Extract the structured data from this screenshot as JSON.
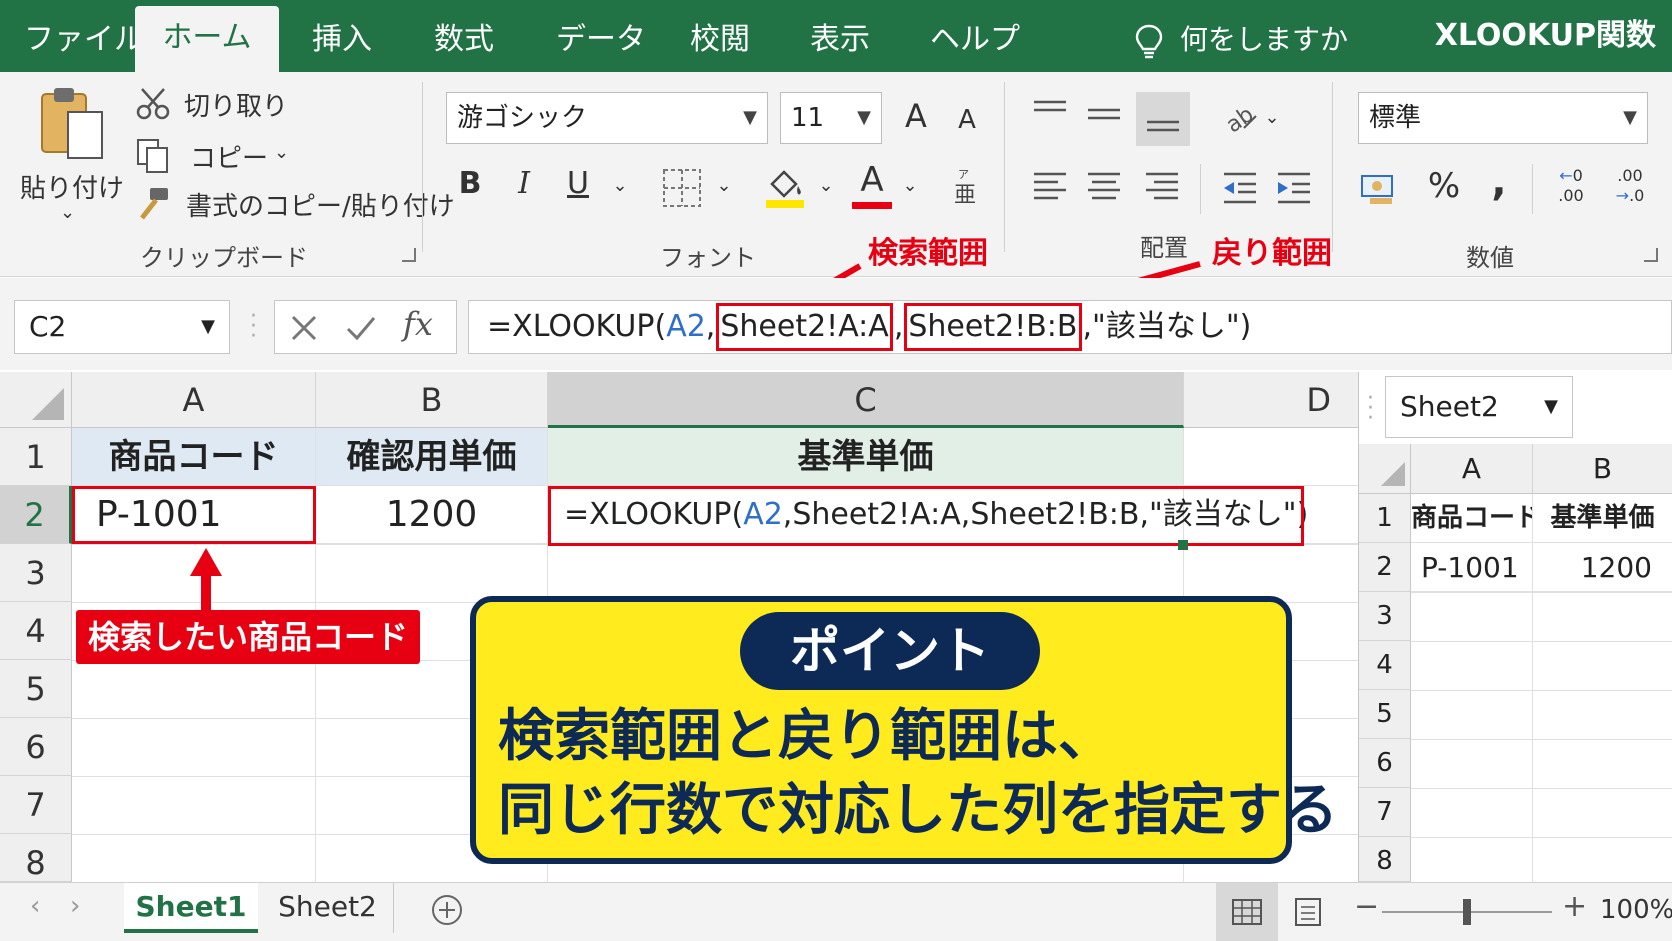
{
  "tabs": [
    "ファイル",
    "ホーム",
    "挿入",
    "数式",
    "データ",
    "校閲",
    "表示",
    "ヘルプ"
  ],
  "tell_me": "何をしますか",
  "brand": "XLOOKUP関数",
  "clipboard": {
    "paste": "貼り付け",
    "cut": "切り取り",
    "copy": "コピー",
    "format_painter": "書式のコピー/貼り付け",
    "group": "クリップボード"
  },
  "font": {
    "name": "游ゴシック",
    "size": "11",
    "group": "フォント",
    "bold": "B",
    "italic": "I",
    "underline": "U",
    "font_color_glyph": "A",
    "grow": "A",
    "shrink": "A",
    "accent_underline": "#e60012",
    "highlight_color": "#ffe600"
  },
  "alignment": {
    "group": "配置"
  },
  "number": {
    "format": "標準",
    "group": "数値",
    "percent": "%",
    "comma": ",",
    "inc_decimal": ".00",
    "dec_decimal": ".0"
  },
  "formula_bar": {
    "cell_ref": "C2",
    "fx": "fx",
    "f_start": "=XLOOKUP(",
    "f_ref": "A2",
    "f_comma1": ",",
    "f_lookup": "Sheet2!A:A",
    "f_comma2": ",",
    "f_return": "Sheet2!B:B",
    "f_comma3": ",",
    "f_end": "\"該当なし\")"
  },
  "annotations": {
    "lookup_range": "検索範囲",
    "return_range": "戻り範囲",
    "lookup_value": "検索したい商品コード"
  },
  "sheet": {
    "columns": [
      "A",
      "B",
      "C",
      "D"
    ],
    "rows": [
      "1",
      "2",
      "3",
      "4",
      "5",
      "6",
      "7",
      "8"
    ],
    "a1": "商品コード",
    "b1": "確認用単価",
    "c1": "基準単価",
    "a2": "P-1001",
    "b2": "1200",
    "c2_start": "=XLOOKUP(",
    "c2_ref": "A2",
    "c2_rest": ",Sheet2!A:A,Sheet2!B:B,\"該当なし\")"
  },
  "point": {
    "badge": "ポイント",
    "line1": "検索範囲と戻り範囲は、",
    "line2": "同じ行数で対応した列を指定する"
  },
  "pane": {
    "sheet_select": "Sheet2",
    "columns": [
      "A",
      "B"
    ],
    "rows": [
      "1",
      "2",
      "3",
      "4",
      "5",
      "6",
      "7",
      "8"
    ],
    "a1": "商品コード",
    "b1": "基準単価",
    "a2": "P-1001",
    "b2": "1200"
  },
  "statusbar": {
    "sheet1": "Sheet1",
    "sheet2": "Sheet2",
    "zoom": "100%"
  },
  "colors": {
    "excel_green": "#217346",
    "annotation_red": "#e60012",
    "callout_yellow": "#ffeb1e",
    "callout_navy": "#0d2a56",
    "reference_blue": "#2f6fc8"
  }
}
